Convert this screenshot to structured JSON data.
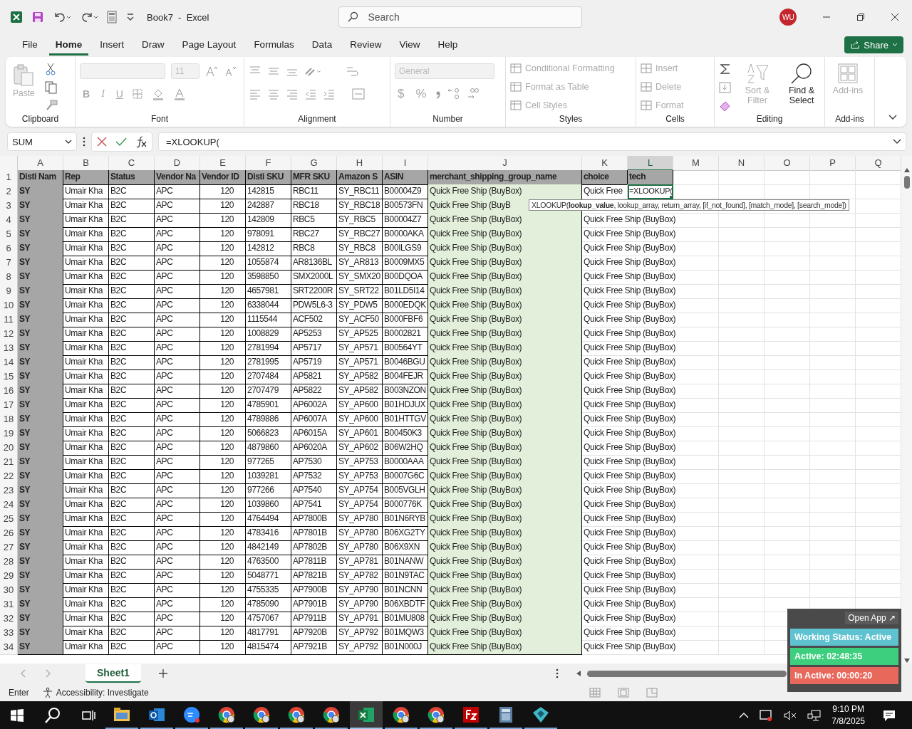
{
  "window": {
    "title": "Book7  -  Excel",
    "search_placeholder": "Search",
    "avatar": "WU",
    "share": "Share"
  },
  "menu_tabs": [
    {
      "label": "File",
      "selected": false
    },
    {
      "label": "Home",
      "selected": true
    },
    {
      "label": "Insert",
      "selected": false
    },
    {
      "label": "Draw",
      "selected": false
    },
    {
      "label": "Page Layout",
      "selected": false
    },
    {
      "label": "Formulas",
      "selected": false
    },
    {
      "label": "Data",
      "selected": false
    },
    {
      "label": "Review",
      "selected": false
    },
    {
      "label": "View",
      "selected": false
    },
    {
      "label": "Help",
      "selected": false
    }
  ],
  "ribbon": {
    "paste": "Paste",
    "font_size": "11",
    "font_buttons": [
      "B",
      "I",
      "U"
    ],
    "number_format": "General",
    "number_buttons": [
      "$",
      "%"
    ],
    "styles": [
      {
        "label": "Conditional Formatting",
        "disabled": true
      },
      {
        "label": "Format as Table",
        "disabled": true
      },
      {
        "label": "Cell Styles",
        "disabled": true
      }
    ],
    "cells": [
      {
        "label": "Insert",
        "disabled": true
      },
      {
        "label": "Delete",
        "disabled": true
      },
      {
        "label": "Format",
        "disabled": true
      }
    ],
    "sort_filter": {
      "label": "Sort & Filter",
      "disabled": true
    },
    "find_select": {
      "label": "Find & Select",
      "disabled": false
    },
    "addins": "Add-ins",
    "groups": [
      "Clipboard",
      "Font",
      "Alignment",
      "Number",
      "Styles",
      "Cells",
      "Editing",
      "Add-ins"
    ]
  },
  "name_box": "SUM",
  "formula": "=XLOOKUP(",
  "columns": [
    {
      "label": "A",
      "selected": false
    },
    {
      "label": "B",
      "selected": false
    },
    {
      "label": "C",
      "selected": false
    },
    {
      "label": "D",
      "selected": false
    },
    {
      "label": "E",
      "selected": false
    },
    {
      "label": "F",
      "selected": false
    },
    {
      "label": "G",
      "selected": false
    },
    {
      "label": "H",
      "selected": false
    },
    {
      "label": "I",
      "selected": false
    },
    {
      "label": "J",
      "selected": false
    },
    {
      "label": "K",
      "selected": false
    },
    {
      "label": "L",
      "selected": true
    },
    {
      "label": "M",
      "selected": false
    },
    {
      "label": "N",
      "selected": false
    },
    {
      "label": "O",
      "selected": false
    },
    {
      "label": "P",
      "selected": false
    },
    {
      "label": "Q",
      "selected": false
    }
  ],
  "rows": [
    {
      "n": "1",
      "kind": "header",
      "cells": [
        "Disti Nam",
        "Rep",
        "Status",
        "Vendor Na",
        "Vendor ID",
        "Disti SKU",
        "MFR SKU",
        "Amazon S",
        "ASIN",
        "merchant_shipping_group_name",
        "choice"
      ],
      "tech": {
        "text": "tech",
        "active": false
      }
    },
    {
      "n": "2",
      "kind": "data",
      "cells": [
        "SY",
        "Umair Kha",
        "B2C",
        "APC",
        "120",
        "142815",
        "RBC11",
        "SY_RBC11",
        "B00004Z9",
        "Quick Free Ship (BuyBox)",
        "Quick Free"
      ],
      "tech": {
        "text": "=XLOOKUP(",
        "active": true
      }
    },
    {
      "n": "3",
      "kind": "data",
      "cells": [
        "SY",
        "Umair Kha",
        "B2C",
        "APC",
        "120",
        "242887",
        "RBC18",
        "SY_RBC18",
        "B00573FN",
        "Quick Free Ship (BuyB"
      ]
    },
    {
      "n": "4",
      "kind": "data",
      "cells": [
        "SY",
        "Umair Kha",
        "B2C",
        "APC",
        "120",
        "142809",
        "RBC5",
        "SY_RBC5",
        "B00004Z7",
        "Quick Free Ship (BuyBox)",
        "Quick Free Ship (BuyBox)"
      ]
    },
    {
      "n": "5",
      "kind": "data",
      "cells": [
        "SY",
        "Umair Kha",
        "B2C",
        "APC",
        "120",
        "978091",
        "RBC27",
        "SY_RBC27",
        "B0000AKA",
        "Quick Free Ship (BuyBox)",
        "Quick Free Ship (BuyBox)"
      ]
    },
    {
      "n": "6",
      "kind": "data",
      "cells": [
        "SY",
        "Umair Kha",
        "B2C",
        "APC",
        "120",
        "142812",
        "RBC8",
        "SY_RBC8",
        "B00ILGS9",
        "Quick Free Ship (BuyBox)",
        "Quick Free Ship (BuyBox)"
      ]
    },
    {
      "n": "7",
      "kind": "data",
      "cells": [
        "SY",
        "Umair Kha",
        "B2C",
        "APC",
        "120",
        "1055874",
        "AR8136BL",
        "SY_AR813",
        "B0009MX5",
        "Quick Free Ship (BuyBox)",
        "Quick Free Ship (BuyBox)"
      ]
    },
    {
      "n": "8",
      "kind": "data",
      "cells": [
        "SY",
        "Umair Kha",
        "B2C",
        "APC",
        "120",
        "3598850",
        "SMX2000L",
        "SY_SMX20",
        "B00DQOA",
        "Quick Free Ship (BuyBox)",
        "Quick Free Ship (BuyBox)"
      ]
    },
    {
      "n": "9",
      "kind": "data",
      "cells": [
        "SY",
        "Umair Kha",
        "B2C",
        "APC",
        "120",
        "4657981",
        "SRT2200R",
        "SY_SRT22",
        "B01LD5I14",
        "Quick Free Ship (BuyBox)",
        "Quick Free Ship (BuyBox)"
      ]
    },
    {
      "n": "10",
      "kind": "data",
      "cells": [
        "SY",
        "Umair Kha",
        "B2C",
        "APC",
        "120",
        "6338044",
        "PDW5L6-3",
        "SY_PDW5",
        "B000EDQK",
        "Quick Free Ship (BuyBox)",
        "Quick Free Ship (BuyBox)"
      ]
    },
    {
      "n": "11",
      "kind": "data",
      "cells": [
        "SY",
        "Umair Kha",
        "B2C",
        "APC",
        "120",
        "1115544",
        "ACF502",
        "SY_ACF50",
        "B000FBF6",
        "Quick Free Ship (BuyBox)",
        "Quick Free Ship (BuyBox)"
      ]
    },
    {
      "n": "12",
      "kind": "data",
      "cells": [
        "SY",
        "Umair Kha",
        "B2C",
        "APC",
        "120",
        "1008829",
        "AP5253",
        "SY_AP525",
        "B0002821",
        "Quick Free Ship (BuyBox)",
        "Quick Free Ship (BuyBox)"
      ]
    },
    {
      "n": "13",
      "kind": "data",
      "cells": [
        "SY",
        "Umair Kha",
        "B2C",
        "APC",
        "120",
        "2781994",
        "AP5717",
        "SY_AP571",
        "B00564YT",
        "Quick Free Ship (BuyBox)",
        "Quick Free Ship (BuyBox)"
      ]
    },
    {
      "n": "14",
      "kind": "data",
      "cells": [
        "SY",
        "Umair Kha",
        "B2C",
        "APC",
        "120",
        "2781995",
        "AP5719",
        "SY_AP571",
        "B0046BGU",
        "Quick Free Ship (BuyBox)",
        "Quick Free Ship (BuyBox)"
      ]
    },
    {
      "n": "15",
      "kind": "data",
      "cells": [
        "SY",
        "Umair Kha",
        "B2C",
        "APC",
        "120",
        "2707484",
        "AP5821",
        "SY_AP582",
        "B004FEJR",
        "Quick Free Ship (BuyBox)",
        "Quick Free Ship (BuyBox)"
      ]
    },
    {
      "n": "16",
      "kind": "data",
      "cells": [
        "SY",
        "Umair Kha",
        "B2C",
        "APC",
        "120",
        "2707479",
        "AP5822",
        "SY_AP582",
        "B003NZON",
        "Quick Free Ship (BuyBox)",
        "Quick Free Ship (BuyBox)"
      ]
    },
    {
      "n": "17",
      "kind": "data",
      "cells": [
        "SY",
        "Umair Kha",
        "B2C",
        "APC",
        "120",
        "4785901",
        "AP6002A",
        "SY_AP600",
        "B01HDJUX",
        "Quick Free Ship (BuyBox)",
        "Quick Free Ship (BuyBox)"
      ]
    },
    {
      "n": "18",
      "kind": "data",
      "cells": [
        "SY",
        "Umair Kha",
        "B2C",
        "APC",
        "120",
        "4789886",
        "AP6007A",
        "SY_AP600",
        "B01HTTGV",
        "Quick Free Ship (BuyBox)",
        "Quick Free Ship (BuyBox)"
      ]
    },
    {
      "n": "19",
      "kind": "data",
      "cells": [
        "SY",
        "Umair Kha",
        "B2C",
        "APC",
        "120",
        "5066823",
        "AP6015A",
        "SY_AP601",
        "B00450K3",
        "Quick Free Ship (BuyBox)",
        "Quick Free Ship (BuyBox)"
      ]
    },
    {
      "n": "20",
      "kind": "data",
      "cells": [
        "SY",
        "Umair Kha",
        "B2C",
        "APC",
        "120",
        "4879860",
        "AP6020A",
        "SY_AP602",
        "B06W2HQ",
        "Quick Free Ship (BuyBox)",
        "Quick Free Ship (BuyBox)"
      ]
    },
    {
      "n": "21",
      "kind": "data",
      "cells": [
        "SY",
        "Umair Kha",
        "B2C",
        "APC",
        "120",
        "977265",
        "AP7530",
        "SY_AP753",
        "B0000AAA",
        "Quick Free Ship (BuyBox)",
        "Quick Free Ship (BuyBox)"
      ]
    },
    {
      "n": "22",
      "kind": "data",
      "cells": [
        "SY",
        "Umair Kha",
        "B2C",
        "APC",
        "120",
        "1039281",
        "AP7532",
        "SY_AP753",
        "B0007G6C",
        "Quick Free Ship (BuyBox)",
        "Quick Free Ship (BuyBox)"
      ]
    },
    {
      "n": "23",
      "kind": "data",
      "cells": [
        "SY",
        "Umair Kha",
        "B2C",
        "APC",
        "120",
        "977266",
        "AP7540",
        "SY_AP754",
        "B005VGLH",
        "Quick Free Ship (BuyBox)",
        "Quick Free Ship (BuyBox)"
      ]
    },
    {
      "n": "24",
      "kind": "data",
      "cells": [
        "SY",
        "Umair Kha",
        "B2C",
        "APC",
        "120",
        "1039860",
        "AP7541",
        "SY_AP754",
        "B000776K",
        "Quick Free Ship (BuyBox)",
        "Quick Free Ship (BuyBox)"
      ]
    },
    {
      "n": "25",
      "kind": "data",
      "cells": [
        "SY",
        "Umair Kha",
        "B2C",
        "APC",
        "120",
        "4764494",
        "AP7800B",
        "SY_AP780",
        "B01N6RYB",
        "Quick Free Ship (BuyBox)",
        "Quick Free Ship (BuyBox)"
      ]
    },
    {
      "n": "26",
      "kind": "data",
      "cells": [
        "SY",
        "Umair Kha",
        "B2C",
        "APC",
        "120",
        "4783416",
        "AP7801B",
        "SY_AP780",
        "B06XG2TY",
        "Quick Free Ship (BuyBox)",
        "Quick Free Ship (BuyBox)"
      ]
    },
    {
      "n": "27",
      "kind": "data",
      "cells": [
        "SY",
        "Umair Kha",
        "B2C",
        "APC",
        "120",
        "4842149",
        "AP7802B",
        "SY_AP780",
        "B06X9XN",
        "Quick Free Ship (BuyBox)",
        "Quick Free Ship (BuyBox)"
      ]
    },
    {
      "n": "28",
      "kind": "data",
      "cells": [
        "SY",
        "Umair Kha",
        "B2C",
        "APC",
        "120",
        "4763500",
        "AP7811B",
        "SY_AP781",
        "B01NANW",
        "Quick Free Ship (BuyBox)",
        "Quick Free Ship (BuyBox)"
      ]
    },
    {
      "n": "29",
      "kind": "data",
      "cells": [
        "SY",
        "Umair Kha",
        "B2C",
        "APC",
        "120",
        "5048771",
        "AP7821B",
        "SY_AP782",
        "B01N9TAC",
        "Quick Free Ship (BuyBox)",
        "Quick Free Ship (BuyBox)"
      ]
    },
    {
      "n": "30",
      "kind": "data",
      "cells": [
        "SY",
        "Umair Kha",
        "B2C",
        "APC",
        "120",
        "4755335",
        "AP7900B",
        "SY_AP790",
        "B01NCNN",
        "Quick Free Ship (BuyBox)",
        "Quick Free Ship (BuyBox)"
      ]
    },
    {
      "n": "31",
      "kind": "data",
      "cells": [
        "SY",
        "Umair Kha",
        "B2C",
        "APC",
        "120",
        "4785090",
        "AP7901B",
        "SY_AP790",
        "B06XBDTF",
        "Quick Free Ship (BuyBox)",
        "Quick Free Ship (BuyBox)"
      ]
    },
    {
      "n": "32",
      "kind": "data",
      "cells": [
        "SY",
        "Umair Kha",
        "B2C",
        "APC",
        "120",
        "4757067",
        "AP7911B",
        "SY_AP791",
        "B01MU808",
        "Quick Free Ship (BuyBox)",
        "Quick Free Ship (BuyBox)"
      ]
    },
    {
      "n": "33",
      "kind": "data",
      "cells": [
        "SY",
        "Umair Kha",
        "B2C",
        "APC",
        "120",
        "4817791",
        "AP7920B",
        "SY_AP792",
        "B01MQW3",
        "Quick Free Ship (BuyBox)",
        "Quick Free Ship (BuyBox)"
      ]
    },
    {
      "n": "34",
      "kind": "data",
      "cells": [
        "SY",
        "Umair Kha",
        "B2C",
        "APC",
        "120",
        "4815474",
        "AP7921B",
        "SY_AP792",
        "B01N000J",
        "Quick Free Ship (BuyBox)",
        "Quick Free Ship (BuyBox)"
      ]
    }
  ],
  "tooltip": "XLOOKUP(**lookup_value**, lookup_array, return_array, [if_not_found], [match_mode], [search_mode])",
  "sheet_tabs": [
    {
      "label": "Sheet1",
      "selected": true
    }
  ],
  "status": {
    "mode": "Enter",
    "accessibility": "Accessibility: Investigate"
  },
  "tracker": {
    "open": "Open App ↗",
    "status": "Working Status: Active",
    "active": "Active: 02:48:35",
    "inactive": "In Active: 00:00:20"
  },
  "taskbar": {
    "apps": [
      {
        "kind": "folder",
        "active": false
      },
      {
        "kind": "mail",
        "active": false
      },
      {
        "kind": "meeting",
        "active": false
      },
      {
        "kind": "browser",
        "active": false
      },
      {
        "kind": "browser",
        "active": false
      },
      {
        "kind": "browser",
        "active": false
      },
      {
        "kind": "browser",
        "active": false
      },
      {
        "kind": "sheet",
        "active": true
      },
      {
        "kind": "browser",
        "active": false
      },
      {
        "kind": "browser",
        "active": false
      },
      {
        "kind": "ftp",
        "active": false
      },
      {
        "kind": "calculator",
        "active": false
      },
      {
        "kind": "gem",
        "active": false
      }
    ],
    "time": "9:10 PM",
    "date": "7/8/2025"
  }
}
